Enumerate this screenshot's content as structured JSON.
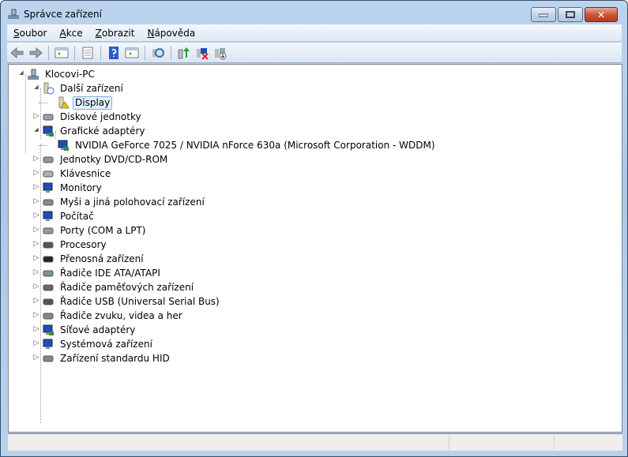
{
  "window": {
    "title": "Správce zařízení",
    "controls": {
      "minimize": "—",
      "maximize": "▫",
      "close": "✕"
    }
  },
  "menu": [
    {
      "label": "Soubor",
      "key": "S",
      "rest": "oubor"
    },
    {
      "label": "Akce",
      "key": "A",
      "rest": "kce"
    },
    {
      "label": "Zobrazit",
      "key": "Z",
      "rest": "obrazit"
    },
    {
      "label": "Nápověda",
      "key": "N",
      "rest": "ápověda"
    }
  ],
  "toolbar": [
    "back-icon",
    "forward-icon",
    "|",
    "show-hide-console-tree-icon",
    "|",
    "properties-icon",
    "|",
    "help-icon",
    "show-action-pane-icon",
    "|",
    "scan-hardware-changes-icon",
    "|",
    "update-driver-icon",
    "disable-device-icon",
    "uninstall-device-icon"
  ],
  "tree": [
    {
      "label": "Klocovi-PC",
      "level": 0,
      "state": "expanded",
      "icon": "computer-icon",
      "color": "#6b8aa8"
    },
    {
      "label": "Další zařízení",
      "level": 1,
      "state": "expanded",
      "icon": "unknown-device-icon",
      "color": "#c9c9a0"
    },
    {
      "label": "Display",
      "level": 2,
      "state": "leaf",
      "icon": "warning-device-icon",
      "color": "#e8c000",
      "selected": true
    },
    {
      "label": "Diskové jednotky",
      "level": 1,
      "state": "collapsed",
      "icon": "disk-drive-icon",
      "color": "#9aa0a6"
    },
    {
      "label": "Grafické adaptéry",
      "level": 1,
      "state": "expanded",
      "icon": "display-adapter-icon",
      "color": "#1b4fb8"
    },
    {
      "label": "NVIDIA GeForce 7025 / NVIDIA nForce 630a (Microsoft Corporation - WDDM)",
      "level": 2,
      "state": "leaf",
      "icon": "display-adapter-icon",
      "color": "#1b4fb8"
    },
    {
      "label": "Jednotky DVD/CD-ROM",
      "level": 1,
      "state": "collapsed",
      "icon": "dvd-drive-icon",
      "color": "#8a9aa0"
    },
    {
      "label": "Klávesnice",
      "level": 1,
      "state": "collapsed",
      "icon": "keyboard-icon",
      "color": "#b0b4b8"
    },
    {
      "label": "Monitory",
      "level": 1,
      "state": "collapsed",
      "icon": "monitor-icon",
      "color": "#1b4fb8"
    },
    {
      "label": "Myši a jiná polohovací zařízení",
      "level": 1,
      "state": "collapsed",
      "icon": "mouse-icon",
      "color": "#888"
    },
    {
      "label": "Počítač",
      "level": 1,
      "state": "collapsed",
      "icon": "computer-icon",
      "color": "#1b4fb8"
    },
    {
      "label": "Porty (COM a LPT)",
      "level": 1,
      "state": "collapsed",
      "icon": "port-icon",
      "color": "#999"
    },
    {
      "label": "Procesory",
      "level": 1,
      "state": "collapsed",
      "icon": "processor-icon",
      "color": "#555"
    },
    {
      "label": "Přenosná zařízení",
      "level": 1,
      "state": "collapsed",
      "icon": "portable-device-icon",
      "color": "#223"
    },
    {
      "label": "Řadiče IDE ATA/ATAPI",
      "level": 1,
      "state": "collapsed",
      "icon": "ide-controller-icon",
      "color": "#7a9a7a"
    },
    {
      "label": "Řadiče paměťových zařízení",
      "level": 1,
      "state": "collapsed",
      "icon": "storage-controller-icon",
      "color": "#666"
    },
    {
      "label": "Řadiče USB (Universal Serial Bus)",
      "level": 1,
      "state": "collapsed",
      "icon": "usb-icon",
      "color": "#555"
    },
    {
      "label": "Řadiče zvuku, videa a her",
      "level": 1,
      "state": "collapsed",
      "icon": "speaker-icon",
      "color": "#888"
    },
    {
      "label": "Síťové adaptéry",
      "level": 1,
      "state": "collapsed",
      "icon": "network-adapter-icon",
      "color": "#1b4fb8"
    },
    {
      "label": "Systémová zařízení",
      "level": 1,
      "state": "collapsed",
      "icon": "system-device-icon",
      "color": "#1b4fb8"
    },
    {
      "label": "Zařízení standardu HID",
      "level": 1,
      "state": "collapsed",
      "icon": "hid-device-icon",
      "color": "#7a8a9a"
    }
  ]
}
